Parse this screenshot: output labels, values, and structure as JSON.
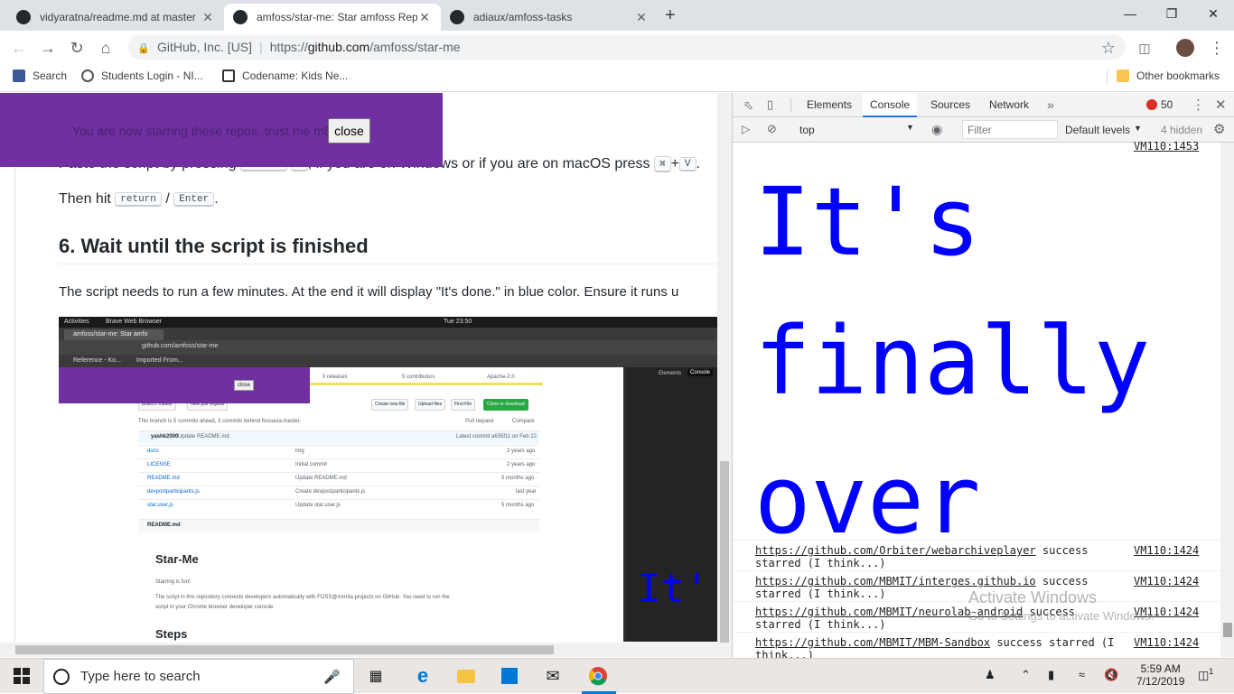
{
  "browser": {
    "tabs": [
      {
        "title": "vidyaratna/readme.md at master"
      },
      {
        "title": "amfoss/star-me: Star amfoss Rep"
      },
      {
        "title": "adiaux/amfoss-tasks"
      }
    ],
    "new_tab_glyph": "+",
    "close_glyph": "✕",
    "omnibox": {
      "org": "GitHub, Inc. [US]",
      "url_scheme": "https://",
      "url_host": "github.com",
      "url_path": "/amfoss/star-me"
    },
    "bookmarks": [
      {
        "label": "Search",
        "icon": "facebook-icon"
      },
      {
        "label": "Students Login - NI...",
        "icon": "globe-icon"
      },
      {
        "label": "Codename: Kids Ne...",
        "icon": "briefcase-icon"
      }
    ],
    "other_bookmarks": "Other bookmarks"
  },
  "banner": {
    "message": "You are now starring these repos, trust me m8",
    "close_label": "close"
  },
  "readme": {
    "paste_text": "Paste the script by pressing",
    "paste_text_end": ", if you are on Windows or if you are on macOS press",
    "mac_key1": "⌘",
    "mac_key2": "V",
    "then_hit": "Then hit",
    "key_return": "return",
    "slash": "/",
    "key_enter": "Enter",
    "heading": "6. Wait until the script is finished",
    "paragraph": "The script needs to run a few minutes. At the end it will display \"It's done.\" in blue color. Ensure it runs u"
  },
  "screenshot": {
    "activities": "Activities",
    "app": "Brave Web Browser",
    "clock": "Tue 23:50",
    "tab": "amfoss/star-me: Star amfo",
    "url": "github.com/amfoss/star-me",
    "bookmark1": "Reference - Ko...",
    "bookmark2": "Imported From...",
    "banner_close": "close",
    "releases": "0 releases",
    "contributors": "5 contributors",
    "license": "Apache-2.0",
    "branch": "Branch: master",
    "new_pr": "New pull request",
    "create_file": "Create new file",
    "upload": "Upload files",
    "find": "Find File",
    "clone": "Clone or download",
    "ahead": "This branch is 5 commits ahead, 3 commits behind fossasia:master.",
    "pull_request": "Pull request",
    "compare": "Compare",
    "committer": "yashk2000",
    "commit_msg": "Update README.md",
    "latest": "Latest commit a635f11 on Feb 22",
    "files": [
      {
        "name": "docs",
        "msg": "img",
        "age": "2 years ago"
      },
      {
        "name": "LICENSE",
        "msg": "Initial commit",
        "age": "2 years ago"
      },
      {
        "name": "README.md",
        "msg": "Update README.md",
        "age": "5 months ago"
      },
      {
        "name": "devpostparticipants.js",
        "msg": "Create devpostparticipants.js",
        "age": "last year"
      },
      {
        "name": "star.user.js",
        "msg": "Update star.user.js",
        "age": "5 months ago"
      }
    ],
    "readme_label": "README.md",
    "title": "Star-Me",
    "starring": "Starring is fun!",
    "desc1": "The script in this repository connects developers automatically with FOSS@Amrita projects on GitHub. You need to run the",
    "desc2": "script in your Chrome browser developer console.",
    "steps": "Steps",
    "dev_elements": "Elements",
    "dev_console": "Console",
    "dev_text": "It'"
  },
  "devtools": {
    "tabs": [
      "Elements",
      "Console",
      "Sources",
      "Network"
    ],
    "active_tab": "Console",
    "error_count": "50",
    "context": "top",
    "filter_placeholder": "Filter",
    "levels": "Default levels",
    "hidden": "4 hidden",
    "top_source": "VM110:1453",
    "big_lines": [
      "It's",
      "finally",
      "over"
    ],
    "logs": [
      {
        "url": "https://github.com/Orbiter/webarchiveplayer",
        "text": " success starred (I think...)",
        "source": "VM110:1424"
      },
      {
        "url": "https://github.com/MBMIT/interges.github.io",
        "text": " success starred (I think...)",
        "source": "VM110:1424"
      },
      {
        "url": "https://github.com/MBMIT/neurolab-android",
        "text": " success starred (I think...)",
        "source": "VM110:1424"
      },
      {
        "url": "https://github.com/MBMIT/MBM-Sandbox",
        "text": " success starred (I think...)",
        "source": "VM110:1424"
      }
    ]
  },
  "watermark": {
    "line1": "Activate Windows",
    "line2": "Go to Settings to activate Windows."
  },
  "taskbar": {
    "search_placeholder": "Type here to search",
    "time": "5:59 AM",
    "date": "7/12/2019",
    "notification_count": "1"
  },
  "colors": {
    "banner": "#7030a0",
    "console_big_text": "#0000ff",
    "devtools_active": "#1a73e8"
  }
}
